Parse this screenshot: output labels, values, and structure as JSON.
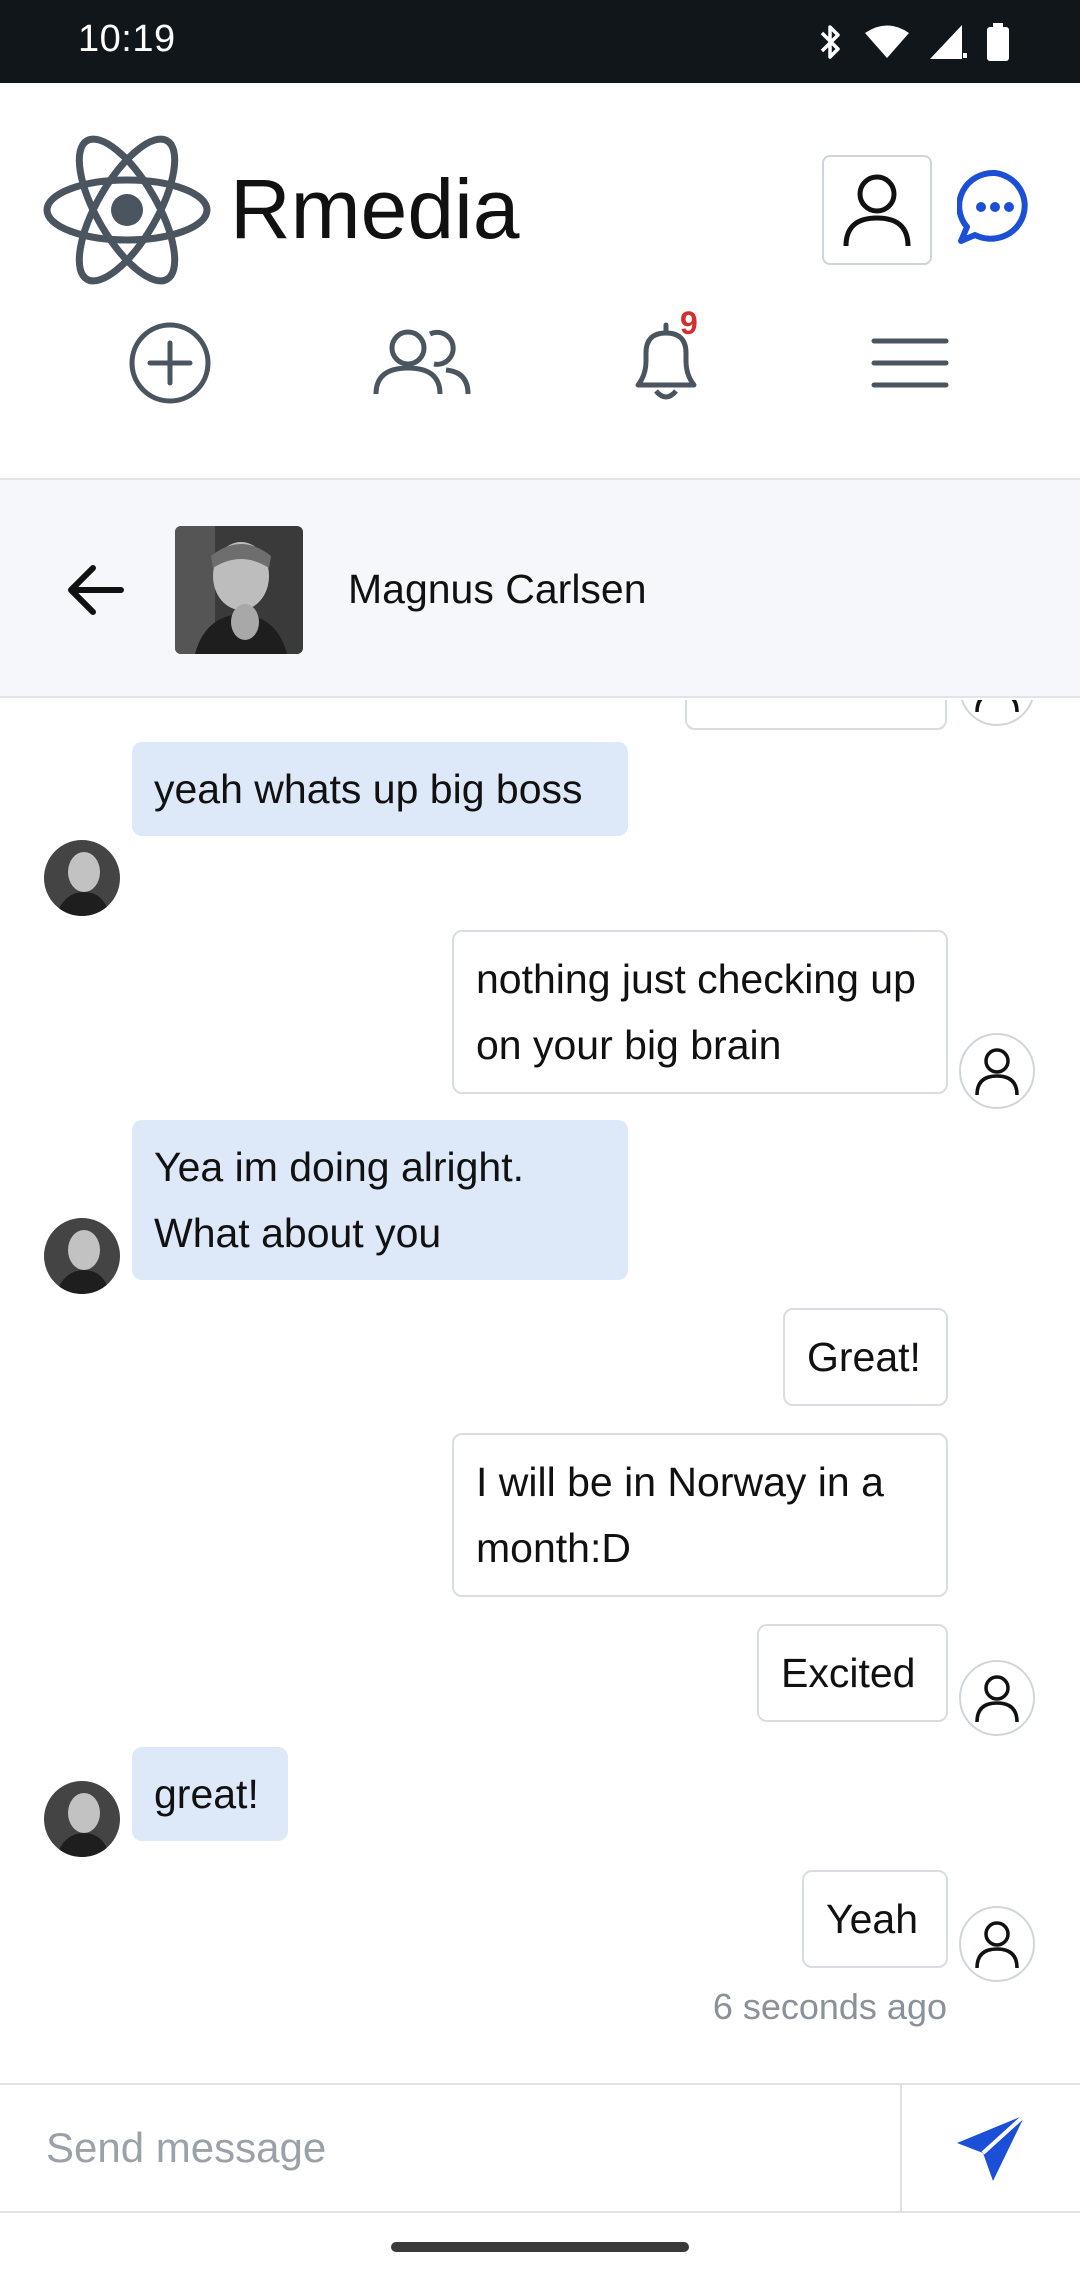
{
  "status_bar": {
    "time": "10:19",
    "icons": [
      "bluetooth-icon",
      "wifi-icon",
      "signal-icon",
      "battery-icon"
    ]
  },
  "header": {
    "brand": "Rmedia",
    "logo_icon": "atom-logo-icon",
    "profile_icon": "user-icon",
    "chat_icon": "chat-bubble-icon",
    "accent_color": "#1a4fd6"
  },
  "nav": {
    "items": [
      {
        "icon": "add-circle-icon"
      },
      {
        "icon": "friends-icon"
      },
      {
        "icon": "bell-icon",
        "badge": "9"
      },
      {
        "icon": "menu-icon"
      }
    ]
  },
  "conversation": {
    "contact_name": "Magnus Carlsen",
    "back_icon": "arrow-left-icon"
  },
  "messages": [
    {
      "from": "contact",
      "text": "yeah whats up big boss"
    },
    {
      "from": "me",
      "text": "nothing just checking up on your big brain"
    },
    {
      "from": "contact",
      "text": "Yea im doing alright. What about you"
    },
    {
      "from": "me",
      "text": "Great!"
    },
    {
      "from": "me",
      "text": "I will be in Norway in a month:D"
    },
    {
      "from": "me",
      "text": "Excited"
    },
    {
      "from": "contact",
      "text": "great!"
    },
    {
      "from": "me",
      "text": "Yeah"
    }
  ],
  "last_message_time": "6 seconds ago",
  "composer": {
    "placeholder": "Send message",
    "value": "",
    "send_icon": "send-icon"
  },
  "colors": {
    "incoming_bubble": "#dde8f9",
    "outgoing_bubble": "#ffffff",
    "badge": "#d32f2f",
    "status_bar": "#11161a"
  }
}
